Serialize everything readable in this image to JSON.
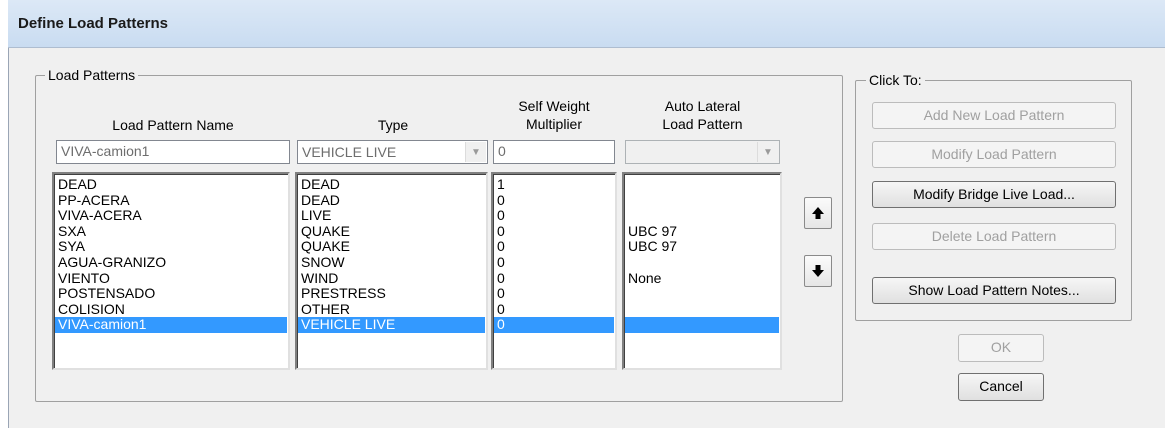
{
  "window": {
    "title": "Define Load Patterns"
  },
  "load_patterns": {
    "group_label": "Load Patterns",
    "headers": {
      "name": "Load Pattern Name",
      "type": "Type",
      "multiplier_line1": "Self Weight",
      "multiplier_line2": "Multiplier",
      "auto_line1": "Auto Lateral",
      "auto_line2": "Load Pattern"
    },
    "edit": {
      "name": "VIVA-camion1",
      "type": "VEHICLE LIVE",
      "multiplier": "0",
      "auto_lateral": ""
    },
    "rows": [
      {
        "name": "DEAD",
        "type": "DEAD",
        "multiplier": "1",
        "auto": ""
      },
      {
        "name": "PP-ACERA",
        "type": "DEAD",
        "multiplier": "0",
        "auto": ""
      },
      {
        "name": "VIVA-ACERA",
        "type": "LIVE",
        "multiplier": "0",
        "auto": ""
      },
      {
        "name": "SXA",
        "type": "QUAKE",
        "multiplier": "0",
        "auto": "UBC 97"
      },
      {
        "name": "SYA",
        "type": "QUAKE",
        "multiplier": "0",
        "auto": "UBC 97"
      },
      {
        "name": "AGUA-GRANIZO",
        "type": "SNOW",
        "multiplier": "0",
        "auto": ""
      },
      {
        "name": "VIENTO",
        "type": "WIND",
        "multiplier": "0",
        "auto": "None"
      },
      {
        "name": "POSTENSADO",
        "type": "PRESTRESS",
        "multiplier": "0",
        "auto": ""
      },
      {
        "name": "COLISION",
        "type": "OTHER",
        "multiplier": "0",
        "auto": ""
      },
      {
        "name": "VIVA-camion1",
        "type": "VEHICLE LIVE",
        "multiplier": "0",
        "auto": ""
      }
    ],
    "selected_index": 9
  },
  "click_to": {
    "group_label": "Click To:",
    "add_new": "Add New Load Pattern",
    "modify": "Modify Load Pattern",
    "modify_bridge": "Modify Bridge Live Load...",
    "delete": "Delete Load Pattern",
    "show_notes": "Show Load Pattern Notes..."
  },
  "buttons": {
    "ok": "OK",
    "cancel": "Cancel"
  },
  "icons": {
    "up": "arrow-up-icon",
    "down": "arrow-down-icon",
    "dropdown": "chevron-down-icon"
  },
  "colors": {
    "selection": "#3399ff",
    "titlebar": "#c9dcf1",
    "dialog_bg": "#f0f0f0"
  }
}
